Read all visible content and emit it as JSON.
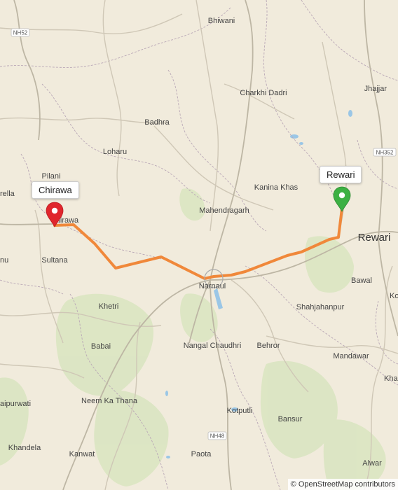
{
  "map": {
    "places": {
      "bhiwani": "Bhiwani",
      "jhajjar": "Jhajjar",
      "charkhi_dadri": "Charkhi Dadri",
      "badhra": "Badhra",
      "loharu": "Loharu",
      "pilani": "Pilani",
      "rella": "rella",
      "kanina_khas": "Kanina Khas",
      "mahendragarh": "Mahendragarh",
      "rewari": "Rewari",
      "chirawa": "Chirawa",
      "sultana": "Sultana",
      "nu": "nu",
      "narnaul": "Narnaul",
      "bawal": "Bawal",
      "ko": "Ko",
      "khetri": "Khetri",
      "shahjahanpur": "Shahjahanpur",
      "babai": "Babai",
      "nangal_chaudhri": "Nangal Chaudhri",
      "behror": "Behror",
      "mandawar": "Mandawar",
      "khairthal": "Khairthal",
      "neem_ka_thana": "Neem Ka Thana",
      "aipurwati": "aipurwati",
      "kotputli": "Kotputli",
      "bansur": "Bansur",
      "khandela": "Khandela",
      "kanwat": "Kanwat",
      "paota": "Paota",
      "alwar": "Alwar"
    },
    "road_shields": {
      "nh52": "NH52",
      "nh352": "NH352",
      "nh48": "NH48"
    },
    "route": {
      "color": "#f0883a",
      "start_label": "Chirawa",
      "end_label": "Rewari",
      "start_marker_color": "#e0262d",
      "end_marker_color": "#3cb043"
    },
    "attribution": "© OpenStreetMap contributors"
  }
}
